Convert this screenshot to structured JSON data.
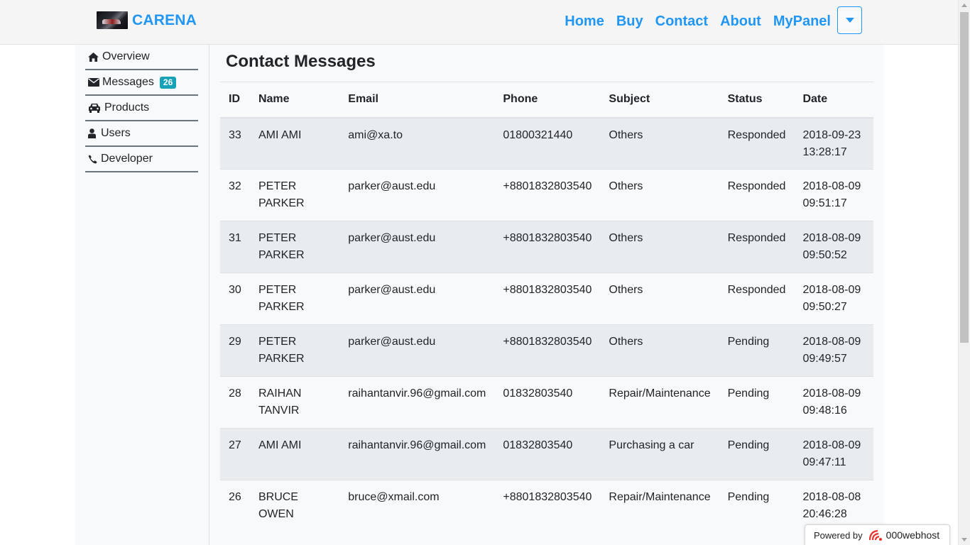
{
  "navbar": {
    "brand": "CARENA",
    "links": [
      "Home",
      "Buy",
      "Contact",
      "About",
      "MyPanel"
    ]
  },
  "sidebar": {
    "items": [
      {
        "label": "Overview",
        "icon": "home-icon"
      },
      {
        "label": "Messages",
        "icon": "envelope-icon",
        "badge": "26"
      },
      {
        "label": "Products",
        "icon": "car-icon"
      },
      {
        "label": "Users",
        "icon": "user-icon"
      },
      {
        "label": "Developer",
        "icon": "phone-icon"
      }
    ]
  },
  "main": {
    "title": "Contact Messages",
    "table": {
      "headers": [
        "ID",
        "Name",
        "Email",
        "Phone",
        "Subject",
        "Status",
        "Date"
      ],
      "rows": [
        [
          "33",
          "AMI AMI",
          "ami@xa.to",
          "01800321440",
          "Others",
          "Responded",
          "2018-09-23 13:28:17"
        ],
        [
          "32",
          "PETER PARKER",
          "parker@aust.edu",
          "+8801832803540",
          "Others",
          "Responded",
          "2018-08-09 09:51:17"
        ],
        [
          "31",
          "PETER PARKER",
          "parker@aust.edu",
          "+8801832803540",
          "Others",
          "Responded",
          "2018-08-09 09:50:52"
        ],
        [
          "30",
          "PETER PARKER",
          "parker@aust.edu",
          "+8801832803540",
          "Others",
          "Responded",
          "2018-08-09 09:50:27"
        ],
        [
          "29",
          "PETER PARKER",
          "parker@aust.edu",
          "+8801832803540",
          "Others",
          "Pending",
          "2018-08-09 09:49:57"
        ],
        [
          "28",
          "RAIHAN TANVIR",
          "raihantanvir.96@gmail.com",
          "01832803540",
          "Repair/Maintenance",
          "Pending",
          "2018-08-09 09:48:16"
        ],
        [
          "27",
          "AMI AMI",
          "raihantanvir.96@gmail.com",
          "01832803540",
          "Purchasing a car",
          "Pending",
          "2018-08-09 09:47:11"
        ],
        [
          "26",
          "BRUCE OWEN",
          "bruce@xmail.com",
          "+8801832803540",
          "Repair/Maintenance",
          "Pending",
          "2018-08-08 20:46:28"
        ]
      ]
    }
  },
  "footer_badge": {
    "powered_by": "Powered by",
    "host": "000webhost"
  },
  "colors": {
    "accent": "#2196f3",
    "badge": "#17a2b8"
  }
}
